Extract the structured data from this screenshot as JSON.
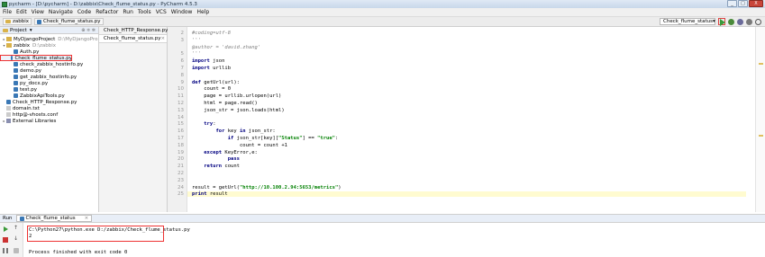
{
  "window": {
    "title": "pycharm - [D:\\pycharm] - D:\\zabbix\\Check_flume_status.py - PyCharm 4.5.3",
    "controls": [
      "_",
      "□",
      "X"
    ]
  },
  "menu": [
    "File",
    "Edit",
    "View",
    "Navigate",
    "Code",
    "Refactor",
    "Run",
    "Tools",
    "VCS",
    "Window",
    "Help"
  ],
  "nav": {
    "crumbs": [
      "zabbix",
      "Check_flume_status.py"
    ],
    "run_config": "Check_flume_status",
    "run_config_arrow": "▾"
  },
  "project": {
    "header": "Project",
    "header_arrow": "▾",
    "header_icons": "⊕ ≑ ✲",
    "tree": [
      {
        "arrow": "▸",
        "label": "MyDjangoProject",
        "sub": "D:\\MyDjangoPro",
        "icon": "folder"
      },
      {
        "arrow": "▾",
        "label": "zabbix",
        "sub": "D:\\zabbix",
        "icon": "folder"
      },
      {
        "arrow": "",
        "label": "Auth.py",
        "sub": "",
        "icon": "py"
      },
      {
        "arrow": "",
        "label": "Check_flume_status.py",
        "sub": "",
        "icon": "py",
        "selected": true
      },
      {
        "arrow": "",
        "label": "check_zabbix_hostinfo.py",
        "sub": "",
        "icon": "py"
      },
      {
        "arrow": "",
        "label": "demo.py",
        "sub": "",
        "icon": "py"
      },
      {
        "arrow": "",
        "label": "get_zabbix_hostinfo.py",
        "sub": "",
        "icon": "py"
      },
      {
        "arrow": "",
        "label": "py_docx.py",
        "sub": "",
        "icon": "py"
      },
      {
        "arrow": "",
        "label": "test.py",
        "sub": "",
        "icon": "py"
      },
      {
        "arrow": "",
        "label": "ZabbixApiTools.py",
        "sub": "",
        "icon": "py"
      },
      {
        "arrow": "",
        "label": "Check_HTTP_Response.py",
        "sub": "",
        "icon": "py"
      },
      {
        "arrow": "",
        "label": "domain.txt",
        "sub": "",
        "icon": "file"
      },
      {
        "arrow": "",
        "label": "http@-vhosts.conf",
        "sub": "",
        "icon": "file"
      },
      {
        "arrow": "▸",
        "label": "External Libraries",
        "sub": "",
        "icon": "lib"
      }
    ]
  },
  "tabs": [
    {
      "label": "Check_HTTP_Response.py",
      "close": "×",
      "active": false
    },
    {
      "label": "Check_flume_status.py",
      "close": "×",
      "active": true
    }
  ],
  "editor": {
    "lines": [
      {
        "n": "2",
        "t": "#coding=utf-8",
        "c": "comment"
      },
      {
        "n": "3",
        "t": "'''",
        "c": "comment"
      },
      {
        "n": "",
        "t": "@author = 'david.zhang'",
        "c": "comment"
      },
      {
        "n": "5",
        "t": "'''",
        "c": "comment"
      },
      {
        "n": "6",
        "t": "import json",
        "c": "kw1"
      },
      {
        "n": "7",
        "t": "import urllib",
        "c": "kw1"
      },
      {
        "n": "8",
        "t": "",
        "c": ""
      },
      {
        "n": "9",
        "t": "def getUrl(url):",
        "c": "kw1"
      },
      {
        "n": "10",
        "t": "    count = 0",
        "c": ""
      },
      {
        "n": "11",
        "t": "    page = urllib.urlopen(url)",
        "c": ""
      },
      {
        "n": "12",
        "t": "    html = page.read()",
        "c": ""
      },
      {
        "n": "13",
        "t": "    json_str = json.loads(html)",
        "c": ""
      },
      {
        "n": "14",
        "t": "",
        "c": ""
      },
      {
        "n": "15",
        "t": "    try:",
        "c": "kw1"
      },
      {
        "n": "16",
        "t": "        for key in json_str:",
        "c": "for"
      },
      {
        "n": "17",
        "t": "            if json_str[key][\"Status\"] == \"true\":",
        "c": "if"
      },
      {
        "n": "18",
        "t": "                count = count +1",
        "c": ""
      },
      {
        "n": "19",
        "t": "    except KeyError,e:",
        "c": "except"
      },
      {
        "n": "20",
        "t": "            pass",
        "c": "kw1"
      },
      {
        "n": "21",
        "t": "    return count",
        "c": "kw1"
      },
      {
        "n": "22",
        "t": "",
        "c": ""
      },
      {
        "n": "23",
        "t": "",
        "c": ""
      },
      {
        "n": "24",
        "t": "result = getUrl(\"http://10.100.2.94:5653/metrics\")",
        "c": "result"
      },
      {
        "n": "25",
        "t": "print result",
        "c": "print"
      }
    ]
  },
  "run": {
    "label": "Run",
    "tab": "Check_flume_status",
    "tab_close": "×",
    "console": [
      "C:\\Python27\\python.exe D:/zabbix/Check_flume_status.py",
      "2",
      "",
      "Process finished with exit code 0"
    ]
  }
}
